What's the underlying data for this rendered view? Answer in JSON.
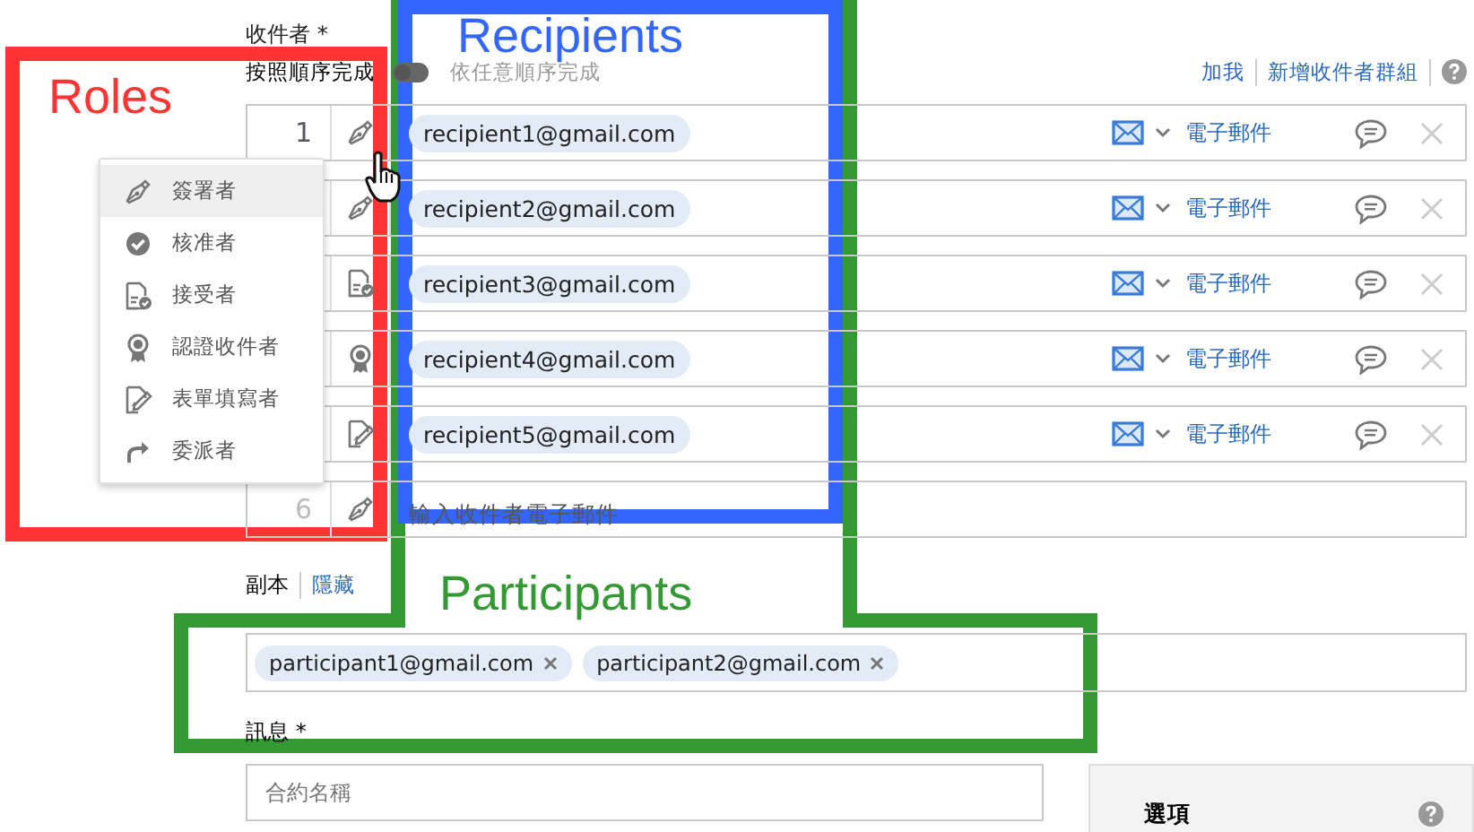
{
  "recipients_section": {
    "label": "收件者 *",
    "order": {
      "in_order_label": "按照順序完成",
      "any_order_label": "依任意順序完成",
      "any_order": false
    },
    "links": [
      "加我",
      "新增收件者群組"
    ]
  },
  "recipients": [
    {
      "number": "1",
      "kind": "signer",
      "email": "recipient1@gmail.com",
      "delivery": "電子郵件"
    },
    {
      "kind": "signer",
      "email": "recipient2@gmail.com",
      "delivery": "電子郵件"
    },
    {
      "kind": "acceptor",
      "email": "recipient3@gmail.com",
      "delivery": "電子郵件"
    },
    {
      "kind": "certified",
      "email": "recipient4@gmail.com",
      "delivery": "電子郵件"
    },
    {
      "kind": "form_filler",
      "email": "recipient5@gmail.com",
      "delivery": "電子郵件"
    },
    {
      "number": "6",
      "kind": "signer",
      "placeholder": "輸入收件者電子郵件"
    }
  ],
  "role_menu": {
    "items": [
      {
        "label": "簽署者",
        "kind": "signer",
        "selected": true
      },
      {
        "label": "核准者",
        "kind": "approver",
        "selected": false
      },
      {
        "label": "接受者",
        "kind": "acceptor",
        "selected": false
      },
      {
        "label": "認證收件者",
        "kind": "certified",
        "selected": false
      },
      {
        "label": "表單填寫者",
        "kind": "form_filler",
        "selected": false
      },
      {
        "label": "委派者",
        "kind": "delegator",
        "selected": false
      }
    ]
  },
  "cc": {
    "label": "副本",
    "link": "隱藏",
    "participants": [
      "participant1@gmail.com",
      "participant2@gmail.com"
    ]
  },
  "message": {
    "label": "訊息 *",
    "name_placeholder": "合約名稱"
  },
  "options": {
    "title": "選項"
  },
  "annotations": [
    {
      "kind": "roles",
      "label": "Roles",
      "color": "#ff3333"
    },
    {
      "kind": "participants",
      "label": "Participants",
      "color": "#339933"
    },
    {
      "kind": "recipients",
      "label": "Recipients",
      "color": "#3366ff"
    }
  ]
}
